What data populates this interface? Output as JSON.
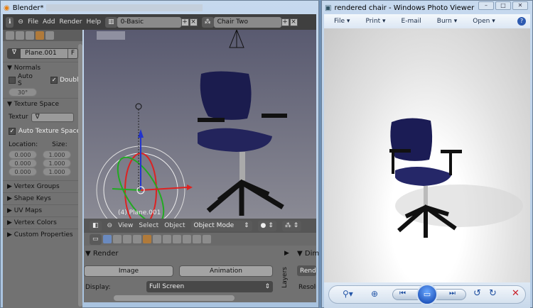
{
  "blender": {
    "title": "Blender*",
    "menu": [
      "File",
      "Add",
      "Render",
      "Help"
    ],
    "screen_layout": "0-Basic",
    "scene": "Chair Two",
    "mesh_name": "Plane.001",
    "fake_user": "F",
    "panels": {
      "normals": "Normals",
      "auto_smooth": "Auto S",
      "double_sided": "Double",
      "angle": "30°",
      "texture_space": "Texture Space",
      "texture_label": "Textur",
      "auto_texture_space": "Auto Texture Space",
      "location": "Location:",
      "size": "Size:",
      "loc_values": [
        "0.000",
        "0.000",
        "0.000"
      ],
      "size_values": [
        "1.000",
        "1.000",
        "1.000"
      ],
      "collapsed": [
        "Vertex Groups",
        "Shape Keys",
        "UV Maps",
        "Vertex Colors",
        "Custom Properties"
      ]
    },
    "viewport_label": "(4) Plane.001",
    "viewport_menu": [
      "View",
      "Select",
      "Object"
    ],
    "mode": "Object Mode",
    "render_panel": {
      "title": "Render",
      "image": "Image",
      "animation": "Animation",
      "display_label": "Display:",
      "display_value": "Full Screen",
      "layers": "Layers",
      "dimensions": "Dim",
      "render_btn": "Rende",
      "resolution": "Resolu"
    }
  },
  "photo_viewer": {
    "title": "rendered chair - Windows Photo Viewer",
    "menu": [
      "File",
      "Print",
      "E-mail",
      "Burn",
      "Open"
    ],
    "help": "?"
  }
}
